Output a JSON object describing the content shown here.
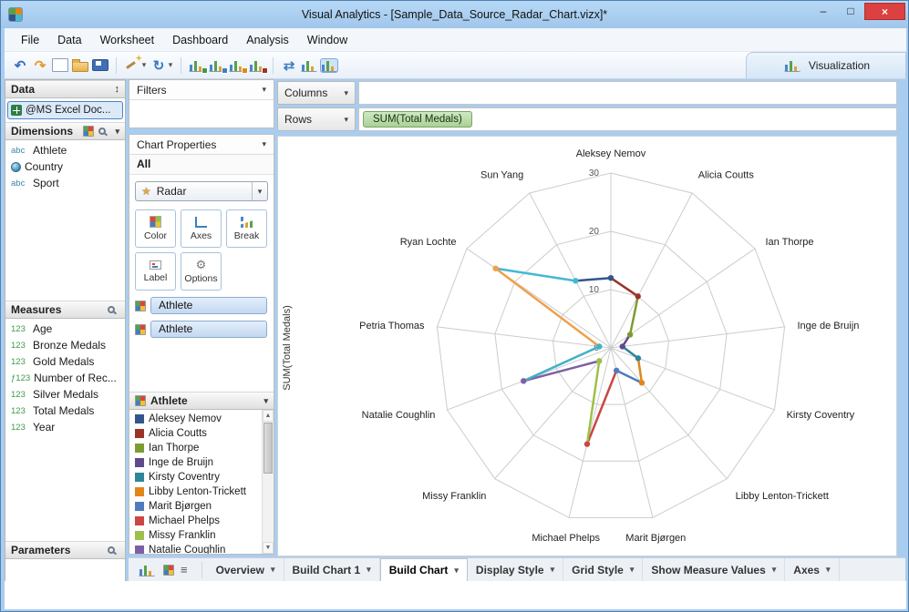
{
  "window": {
    "title": "Visual Analytics - [Sample_Data_Source_Radar_Chart.vizx]*",
    "minimize": "–",
    "maximize": "□",
    "close": "×"
  },
  "glyphs": {
    "caret_down": "▾",
    "updown": "↕",
    "scroll_up": "▲",
    "scroll_down": "▼",
    "sheet_list": "≡",
    "gear": "⚙",
    "radar_star": "★"
  },
  "menu": {
    "items": [
      "File",
      "Data",
      "Worksheet",
      "Dashboard",
      "Analysis",
      "Window"
    ]
  },
  "toolbar": {
    "visualization_label": "Visualization",
    "icons": [
      {
        "name": "undo-icon",
        "glyph": "↶",
        "color": "#3a6fc0"
      },
      {
        "name": "redo-icon",
        "glyph": "↷",
        "color": "#e39b2d"
      },
      {
        "name": "new-workbook-icon",
        "kind": "doc"
      },
      {
        "name": "open-workbook-icon",
        "kind": "folder"
      },
      {
        "name": "save-icon",
        "kind": "save"
      },
      {
        "name": "sep"
      },
      {
        "name": "format-wand-icon",
        "kind": "wand"
      },
      {
        "name": "format-dropdown-icon",
        "glyph": "▾",
        "color": "#555",
        "small": true
      },
      {
        "name": "refresh-icon",
        "glyph": "↻",
        "color": "#3a78c2"
      },
      {
        "name": "refresh-dropdown-icon",
        "glyph": "▾",
        "color": "#555",
        "small": true
      },
      {
        "name": "sep"
      },
      {
        "name": "new-chart-icon",
        "kind": "bars",
        "badge": "#3f9b47"
      },
      {
        "name": "new-pivot-icon",
        "kind": "bars",
        "badge": "#3f7fc1"
      },
      {
        "name": "new-summary-icon",
        "kind": "bars",
        "badge": "#e0861a"
      },
      {
        "name": "duplicate-sheet-icon",
        "kind": "bars",
        "badge": "#9c3328"
      },
      {
        "name": "sep"
      },
      {
        "name": "swap-rows-columns-icon",
        "glyph": "⇄",
        "color": "#3f7fc1"
      },
      {
        "name": "sort-bars-icon",
        "kind": "bars"
      },
      {
        "name": "show-visualization-icon",
        "kind": "bars",
        "active": true
      }
    ]
  },
  "data_panel": {
    "title": "Data",
    "source": "@MS Excel Doc...",
    "dimensions": {
      "title": "Dimensions",
      "items": [
        {
          "prefix": "abc",
          "icon": "abc",
          "label": "Athlete"
        },
        {
          "icon": "globe",
          "label": "Country"
        },
        {
          "prefix": "abc",
          "icon": "abc",
          "label": "Sport"
        }
      ]
    },
    "measures": {
      "title": "Measures",
      "items": [
        {
          "prefix": "123",
          "label": "Age"
        },
        {
          "prefix": "123",
          "label": "Bronze Medals"
        },
        {
          "prefix": "123",
          "label": "Gold Medals"
        },
        {
          "prefix": "ƒ123",
          "label": "Number of Rec..."
        },
        {
          "prefix": "123",
          "label": "Silver Medals"
        },
        {
          "prefix": "123",
          "label": "Total Medals"
        },
        {
          "prefix": "123",
          "label": "Year"
        }
      ]
    },
    "parameters": {
      "title": "Parameters"
    }
  },
  "properties_panel": {
    "filters_title": "Filters",
    "chart_properties_title": "Chart Properties",
    "scope_label": "All",
    "chart_type": "Radar",
    "buttons": [
      {
        "label": "Color",
        "icon": "color"
      },
      {
        "label": "Axes",
        "icon": "axes"
      },
      {
        "label": "Break",
        "icon": "break"
      },
      {
        "label": "Label",
        "icon": "label"
      },
      {
        "label": "Options",
        "icon": "options"
      }
    ],
    "shelf_pills": [
      "Athlete",
      "Athlete"
    ],
    "legend": {
      "title": "Athlete",
      "items": [
        {
          "label": "Aleksey Nemov",
          "color": "#34558b"
        },
        {
          "label": "Alicia Coutts",
          "color": "#9c3328"
        },
        {
          "label": "Ian Thorpe",
          "color": "#7d9b34"
        },
        {
          "label": "Inge de Bruijn",
          "color": "#5f4b8b"
        },
        {
          "label": "Kirsty Coventry",
          "color": "#2f869b"
        },
        {
          "label": "Libby Lenton-Trickett",
          "color": "#e0861a"
        },
        {
          "label": "Marit Bjørgen",
          "color": "#4f7cbe"
        },
        {
          "label": "Michael Phelps",
          "color": "#cb4743"
        },
        {
          "label": "Missy Franklin",
          "color": "#9dc04b"
        },
        {
          "label": "Natalie Coughlin",
          "color": "#7e5fa4"
        }
      ]
    }
  },
  "shelves": {
    "columns_label": "Columns",
    "rows_label": "Rows",
    "rows_pill": "SUM(Total Medals)"
  },
  "chart_data": {
    "type": "radar",
    "axis_label": "SUM(Total Medals)",
    "ticks": [
      0,
      10,
      20,
      30
    ],
    "max": 30,
    "grid": true,
    "categories": [
      "Aleksey Nemov",
      "Alicia Coutts",
      "Ian Thorpe",
      "Inge de Bruijn",
      "Kirsty Coventry",
      "Libby Lenton-Trickett",
      "Marit Bjørgen",
      "Michael Phelps",
      "Missy Franklin",
      "Natalie Coughlin",
      "Petria Thomas",
      "Ryan Lochte",
      "Sun Yang"
    ],
    "values": [
      12,
      10,
      4,
      2,
      5,
      8,
      4,
      17,
      3,
      16,
      2,
      24,
      13
    ],
    "colors": [
      "#34558b",
      "#9c3328",
      "#7d9b34",
      "#5f4b8b",
      "#2f869b",
      "#e0861a",
      "#4f7cbe",
      "#cb4743",
      "#9dc04b",
      "#7e5fa4",
      "#41b1c8",
      "#f0a04b",
      "#45b8d4"
    ]
  },
  "bottom_tabs": {
    "icons": [
      {
        "name": "new-chart-tab-icon",
        "kind": "bars"
      },
      {
        "name": "new-dashboard-tab-icon",
        "kind": "grid"
      },
      {
        "name": "sheet-list-icon",
        "glyph": "≡"
      }
    ],
    "tabs": [
      {
        "label": "Overview"
      },
      {
        "label": "Build Chart 1"
      },
      {
        "label": "Build Chart",
        "active": true
      },
      {
        "label": "Display Style"
      },
      {
        "label": "Grid Style"
      },
      {
        "label": "Show Measure Values"
      },
      {
        "label": "Axes"
      }
    ]
  }
}
